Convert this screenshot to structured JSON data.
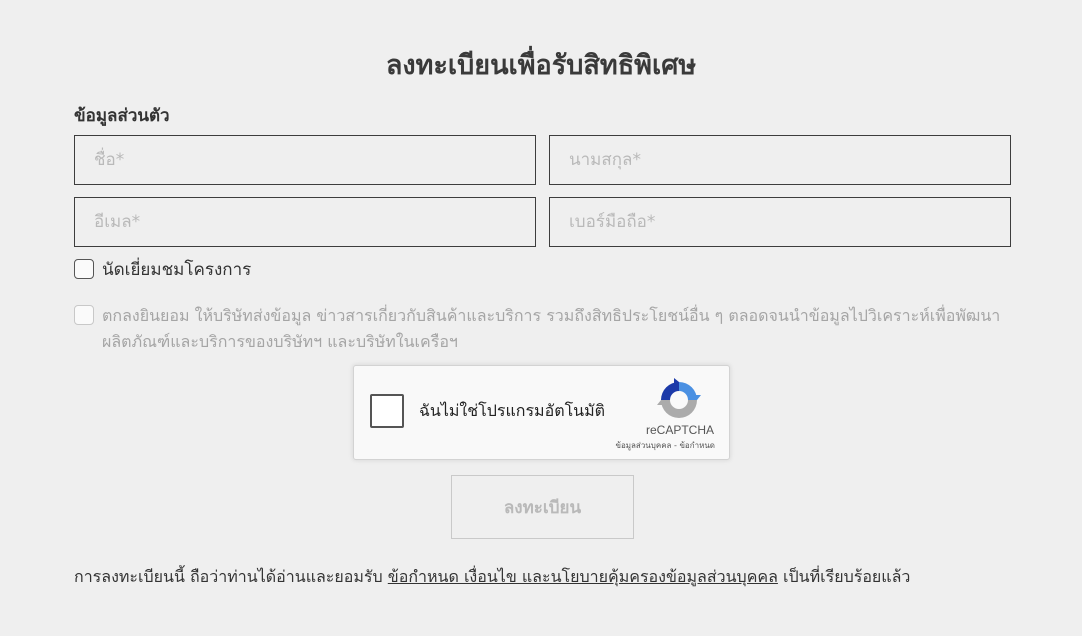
{
  "form": {
    "title": "ลงทะเบียนเพื่อรับสิทธิพิเศษ",
    "section_label": "ข้อมูลส่วนตัว",
    "fields": {
      "first_name": {
        "placeholder": "ชื่อ*",
        "value": ""
      },
      "last_name": {
        "placeholder": "นามสกุล*",
        "value": ""
      },
      "email": {
        "placeholder": "อีเมล*",
        "value": ""
      },
      "phone": {
        "placeholder": "เบอร์มือถือ*",
        "value": ""
      }
    },
    "visit_checkbox_label": "นัดเยี่ยมชมโครงการ",
    "consent_checkbox_label": "ตกลงยินยอม ให้บริษัทส่งข้อมูล ข่าวสารเกี่ยวกับสินค้าและบริการ รวมถึงสิทธิประโยชน์อื่น ๆ ตลอดจนนำข้อมูลไปวิเคราะห์เพื่อพัฒนาผลิตภัณฑ์และบริการของบริษัทฯ และบริษัทในเครือฯ",
    "submit_label": "ลงทะเบียน"
  },
  "recaptcha": {
    "label": "ฉันไม่ใช่โปรแกรมอัตโนมัติ",
    "brand": "reCAPTCHA",
    "privacy_link": "ข้อมูลส่วนบุคคล",
    "separator": " - ",
    "terms_link": "ข้อกำหนด",
    "logo_icon": "recaptcha-logo-icon",
    "colors": {
      "blue": "#4a90e2",
      "dark_blue": "#1c3aa9",
      "gray": "#ababab"
    }
  },
  "footer": {
    "prefix": "การลงทะเบียนนี้ ถือว่าท่านได้อ่านและยอมรับ",
    "link": "ข้อกำหนด เงื่อนไข และนโยบายคุ้มครองข้อมูลส่วนบุคคล",
    "suffix": "เป็นที่เรียบร้อยแล้ว"
  },
  "colors": {
    "background": "#efefef",
    "field_border": "#3d3d3d",
    "placeholder": "#b9b9b9",
    "muted_text": "#a5a5a5"
  }
}
